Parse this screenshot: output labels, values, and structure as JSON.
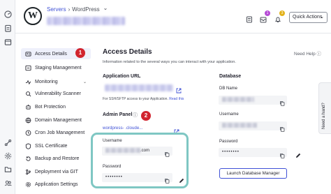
{
  "header": {
    "breadcrumb_parent": "Servers",
    "breadcrumb_sep": "›",
    "breadcrumb_current": "WordPress",
    "breadcrumb_chevron": "⌄",
    "logo_letter": "W",
    "quick_actions": "Quick Actions",
    "notifications": [
      "1",
      "3"
    ],
    "brand_color": "#3f51d6"
  },
  "sidebar": {
    "items": [
      {
        "label": "Access Details",
        "icon": "user-card-icon",
        "active": true
      },
      {
        "label": "Staging Management",
        "icon": "staging-icon"
      },
      {
        "label": "Monitoring",
        "icon": "monitoring-icon",
        "expand": "⌄"
      },
      {
        "label": "Vulnerability Scanner",
        "icon": "scanner-icon"
      },
      {
        "label": "Bot Protection",
        "icon": "bot-icon"
      },
      {
        "label": "Domain Management",
        "icon": "globe-icon"
      },
      {
        "label": "Cron Job Management",
        "icon": "clock-icon"
      },
      {
        "label": "SSL Certificate",
        "icon": "ssl-icon"
      },
      {
        "label": "Backup and Restore",
        "icon": "backup-icon"
      },
      {
        "label": "Deployment via GIT",
        "icon": "git-icon"
      },
      {
        "label": "Application Settings",
        "icon": "gear-icon"
      }
    ]
  },
  "callouts": [
    "1",
    "2"
  ],
  "main": {
    "title": "Access Details",
    "need_help": "Need Help",
    "subtitle": "Information related to the several ways you can interact with your application.",
    "application_url_label": "Application URL",
    "sftp_note": "For SSH/SFTP access to your Application.",
    "read_this": "Read this",
    "admin_panel_label": "Admin Panel",
    "wp_admin_url": "wordpress-             .cloude...",
    "username_label": "Username",
    "username_suffix": ".com",
    "password_label": "Password",
    "password_mask": "••••••••"
  },
  "database": {
    "title": "Database",
    "db_name_label": "DB Name",
    "username_label": "Username",
    "password_label": "Password",
    "password_mask": "••••••••",
    "launch_button": "Launch Database Manager"
  },
  "help_tab": "Need a hand?"
}
